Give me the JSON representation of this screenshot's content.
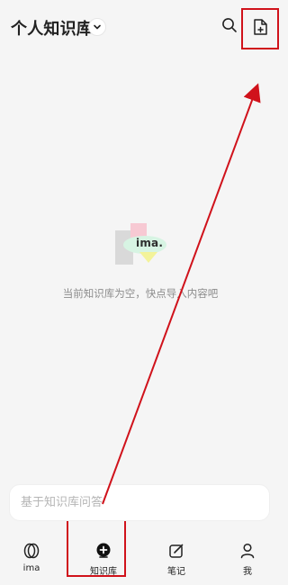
{
  "header": {
    "title": "个人知识库"
  },
  "empty_state": {
    "logo_text": "ima.",
    "message": "当前知识库为空，快点导入内容吧"
  },
  "ask_input": {
    "placeholder": "基于知识库问答"
  },
  "bottom_nav": {
    "items": [
      {
        "label": "ima",
        "icon": "ima-rings-icon"
      },
      {
        "label": "知识库",
        "icon": "knowledge-base-icon"
      },
      {
        "label": "笔记",
        "icon": "note-edit-icon"
      },
      {
        "label": "我",
        "icon": "person-icon"
      }
    ]
  },
  "colors": {
    "background": "#f5f5f5",
    "annotation_red": "#d0121b",
    "text_primary": "#222222",
    "text_secondary": "#8c8c8c",
    "placeholder": "#b5b5b5"
  }
}
